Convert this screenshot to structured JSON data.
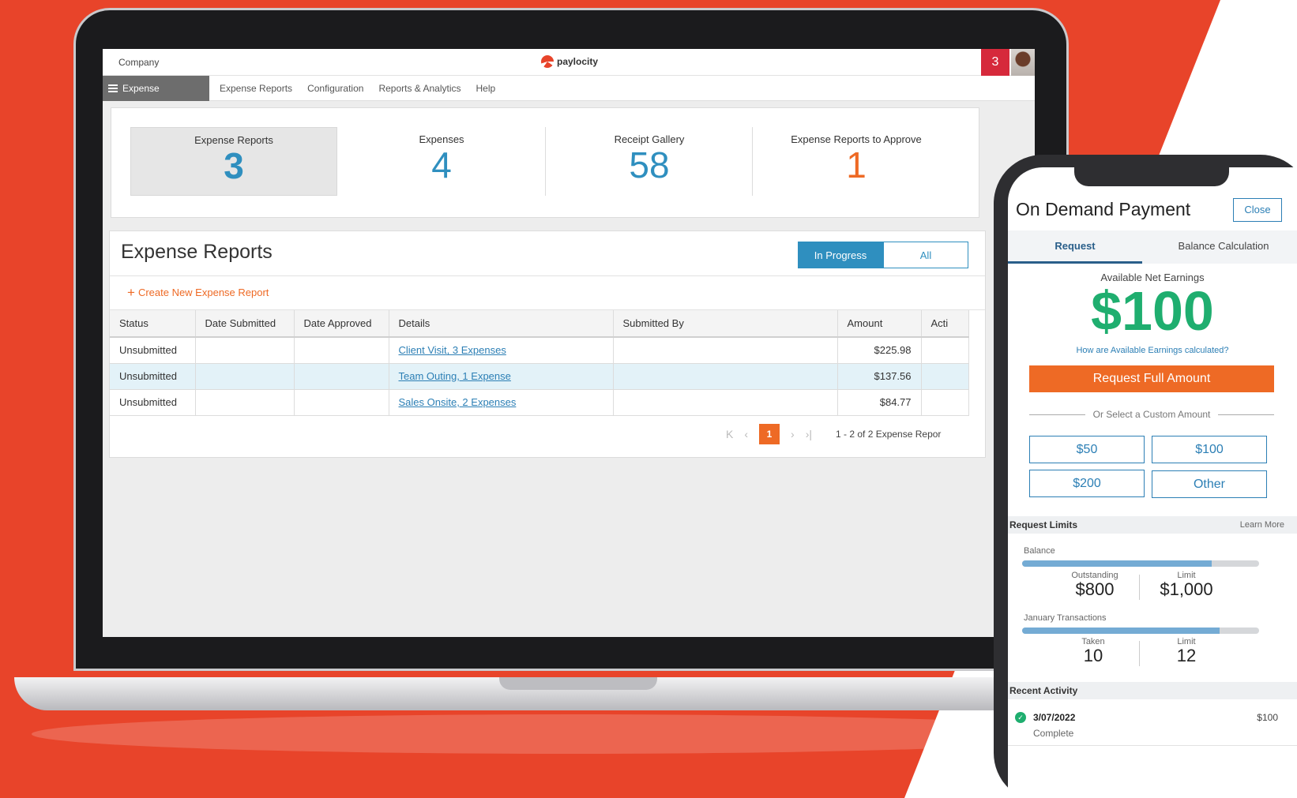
{
  "desktop": {
    "company": "Company",
    "brand": "paylocity",
    "notifications": "3",
    "nav": {
      "module": "Expense",
      "items": [
        "Expense Reports",
        "Configuration",
        "Reports & Analytics",
        "Help"
      ]
    },
    "summary": [
      {
        "label": "Expense Reports",
        "value": "3"
      },
      {
        "label": "Expenses",
        "value": "4"
      },
      {
        "label": "Receipt Gallery",
        "value": "58"
      },
      {
        "label": "Expense Reports to Approve",
        "value": "1"
      }
    ],
    "reports": {
      "title": "Expense Reports",
      "filters": [
        "In Progress",
        "All"
      ],
      "create_label": "Create New Expense Report",
      "columns": [
        "Status",
        "Date Submitted",
        "Date Approved",
        "Details",
        "Submitted By",
        "Amount",
        "Acti"
      ],
      "rows": [
        {
          "status": "Unsubmitted",
          "date_submitted": "",
          "date_approved": "",
          "details": "Client Visit, 3 Expenses",
          "submitted_by": "",
          "amount": "$225.98"
        },
        {
          "status": "Unsubmitted",
          "date_submitted": "",
          "date_approved": "",
          "details": "Team Outing, 1 Expense",
          "submitted_by": "",
          "amount": "$137.56"
        },
        {
          "status": "Unsubmitted",
          "date_submitted": "",
          "date_approved": "",
          "details": "Sales Onsite, 2 Expenses",
          "submitted_by": "",
          "amount": "$84.77"
        }
      ],
      "pager": {
        "first": "K",
        "prev": "‹",
        "current": "1",
        "next": "›",
        "last": "›|",
        "info": "1 - 2 of 2 Expense Repor"
      }
    }
  },
  "mobile": {
    "title": "On Demand Payment",
    "close": "Close",
    "tabs": [
      "Request",
      "Balance Calculation"
    ],
    "available_label": "Available Net Earnings",
    "available_amount": "$100",
    "how_link": "How are Available Earnings calculated?",
    "request_full": "Request Full Amount",
    "or_custom": "Or Select a Custom Amount",
    "amounts": [
      "$50",
      "$100",
      "$200",
      "Other"
    ],
    "limits": {
      "title": "Request Limits",
      "learn_more": "Learn More",
      "balance": {
        "label": "Balance",
        "fill": 0.8,
        "outstanding_label": "Outstanding",
        "outstanding": "$800",
        "limit_label": "Limit",
        "limit": "$1,000"
      },
      "transactions": {
        "label": "January Transactions",
        "fill": 0.8333,
        "taken_label": "Taken",
        "taken": "10",
        "limit_label": "Limit",
        "limit": "12"
      }
    },
    "recent": {
      "title": "Recent Activity",
      "items": [
        {
          "date": "3/07/2022",
          "status": "Complete",
          "amount": "$100"
        }
      ]
    }
  },
  "colors": {
    "accent_red": "#e8442a",
    "orange": "#ee6a25",
    "blue": "#2f8fbf",
    "green": "#1fae6f"
  }
}
